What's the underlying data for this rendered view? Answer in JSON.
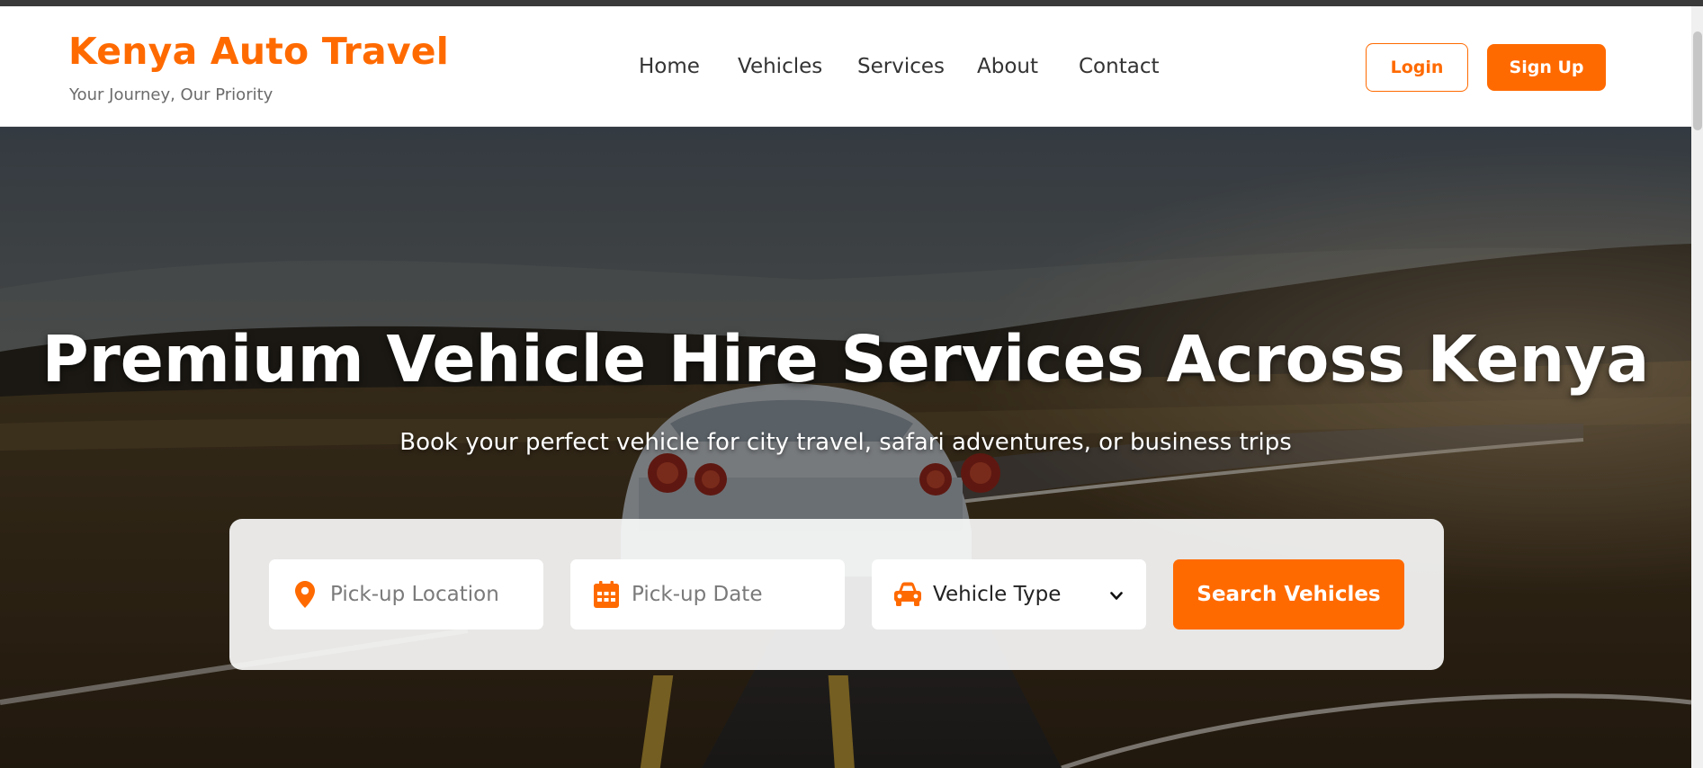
{
  "brand": {
    "title": "Kenya Auto Travel",
    "tagline": "Your Journey, Our Priority",
    "accent_color": "#ff6a00"
  },
  "nav": {
    "items": [
      {
        "label": "Home"
      },
      {
        "label": "Vehicles"
      },
      {
        "label": "Services"
      },
      {
        "label": "About"
      },
      {
        "label": "Contact"
      }
    ]
  },
  "auth": {
    "login_label": "Login",
    "signup_label": "Sign Up"
  },
  "hero": {
    "title": "Premium Vehicle Hire Services Across Kenya",
    "subtitle": "Book your perfect vehicle for city travel, safari adventures, or business trips"
  },
  "search": {
    "pickup_location": {
      "placeholder": "Pick-up Location",
      "icon": "map-pin-icon"
    },
    "pickup_date": {
      "placeholder": "Pick-up Date",
      "icon": "calendar-icon"
    },
    "vehicle_type": {
      "selected": "Vehicle Type",
      "icon": "car-icon"
    },
    "submit_label": "Search Vehicles"
  }
}
